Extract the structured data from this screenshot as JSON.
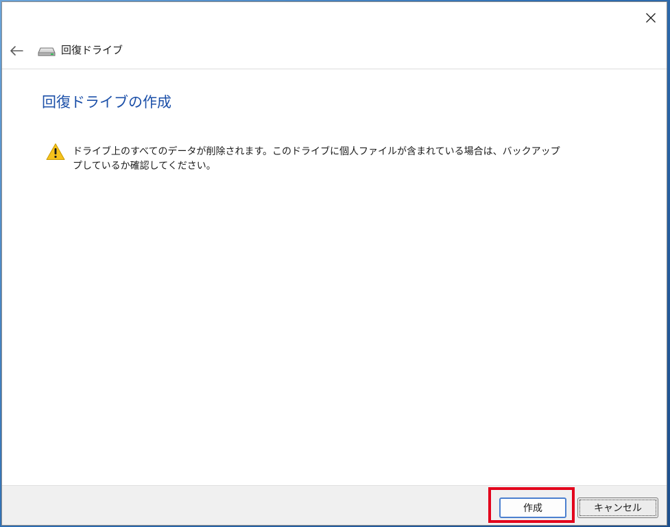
{
  "nav": {
    "title": "回復ドライブ"
  },
  "content": {
    "heading": "回復ドライブの作成",
    "warning_line1": "ドライブ上のすべてのデータが削除されます。このドライブに個人ファイルが含まれている場合は、バックアップ",
    "warning_line2": "プしているか確認してください。"
  },
  "footer": {
    "create_label": "作成",
    "cancel_label": "キャンセル"
  },
  "icons": {
    "close": "close-icon",
    "back": "back-arrow-icon",
    "drive": "drive-icon",
    "warning": "warning-icon"
  },
  "colors": {
    "heading": "#1b4fa8",
    "warning": "#f6c21c",
    "highlight": "#e3001b",
    "primary_border": "#4a7fcf"
  }
}
